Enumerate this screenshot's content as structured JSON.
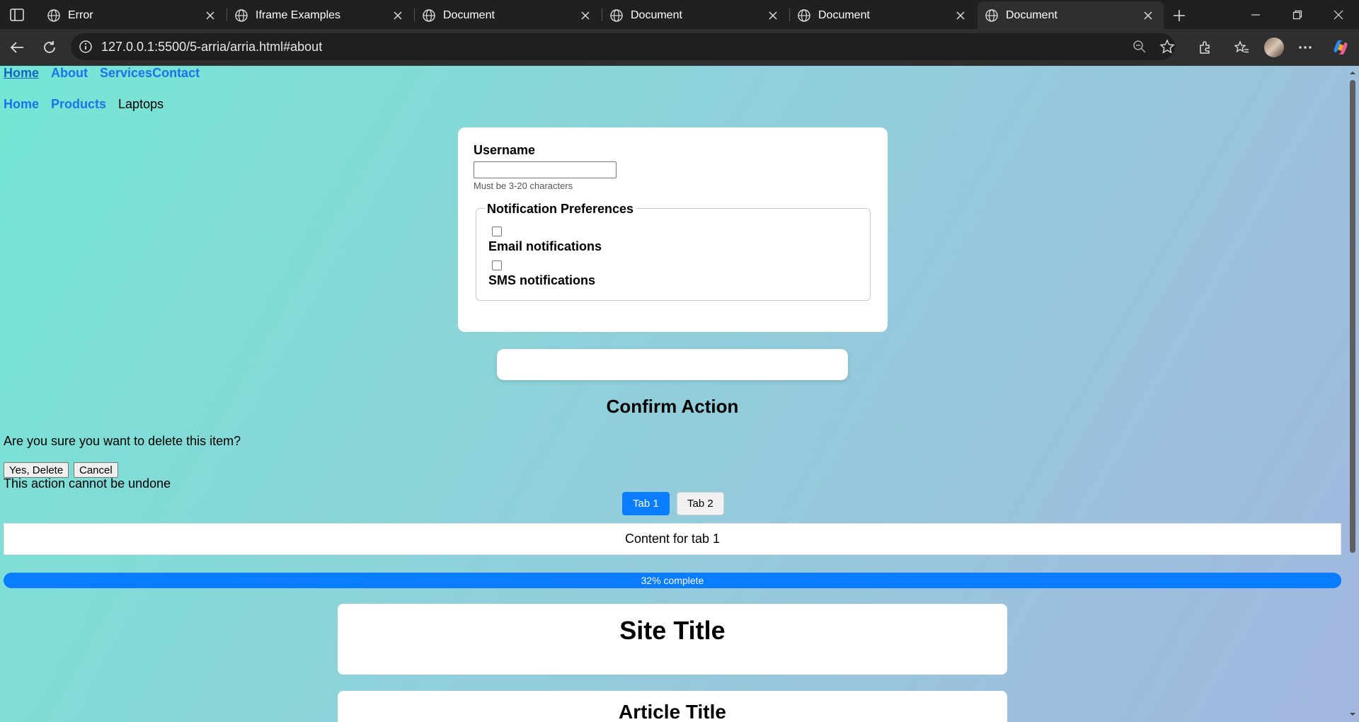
{
  "browser": {
    "tabs": [
      {
        "title": "Error",
        "active": false
      },
      {
        "title": "Iframe Examples",
        "active": false
      },
      {
        "title": "Document",
        "active": false
      },
      {
        "title": "Document",
        "active": false
      },
      {
        "title": "Document",
        "active": false
      },
      {
        "title": "Document",
        "active": true
      }
    ],
    "url": "127.0.0.1:5500/5-arria/arria.html#about"
  },
  "page": {
    "nav_main": [
      "Home",
      "About",
      "Services",
      "Contact"
    ],
    "breadcrumb": {
      "links": [
        "Home",
        "Products"
      ],
      "current": "Laptops"
    },
    "form": {
      "username_label": "Username",
      "username_value": "",
      "username_hint": "Must be 3-20 characters",
      "fieldset_legend": "Notification Preferences",
      "email_label": "Email notifications",
      "sms_label": "SMS notifications"
    },
    "dialog": {
      "title": "Confirm Action",
      "text": "Are you sure you want to delete this item?",
      "confirm_label": "Yes, Delete",
      "cancel_label": "Cancel",
      "note": "This action cannot be undone"
    },
    "tabs": {
      "tab1_label": "Tab 1",
      "tab2_label": "Tab 2",
      "panel_text": "Content for tab 1"
    },
    "progress": {
      "value": 0.32,
      "label": "32% complete"
    },
    "site_title": "Site Title",
    "article_title": "Article Title"
  }
}
